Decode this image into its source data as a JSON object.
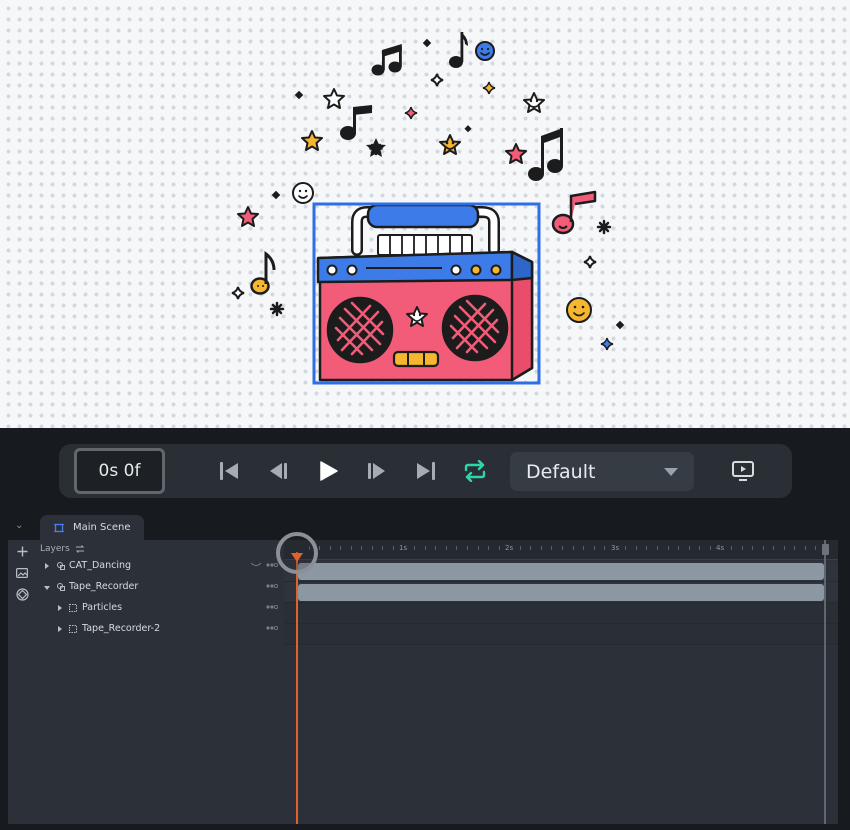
{
  "controls": {
    "timecode": "0s 0f",
    "preset": "Default"
  },
  "tabs": [
    {
      "label": "Main Scene"
    }
  ],
  "layers": {
    "header": "Layers",
    "items": [
      {
        "name": "CAT_Dancing",
        "level": 0,
        "expanded": false
      },
      {
        "name": "Tape_Recorder",
        "level": 0,
        "expanded": true
      },
      {
        "name": "Particles",
        "level": 1,
        "expanded": false
      },
      {
        "name": "Tape_Recorder-2",
        "level": 1,
        "expanded": false
      }
    ]
  },
  "timeline": {
    "ticks": [
      "1s",
      "2s",
      "3s",
      "4s"
    ],
    "playhead_seconds": 0,
    "duration_seconds": 5
  },
  "colors": {
    "accent_blue": "#2f6fe6",
    "playhead": "#e1622d",
    "loop_active": "#2fd5a8",
    "boombox_pink": "#f25c78",
    "boombox_blue": "#3d7ce8",
    "sticker_yellow": "#f6b62f"
  },
  "icons": [
    "skip-start-icon",
    "step-back-icon",
    "play-icon",
    "step-forward-icon",
    "skip-end-icon",
    "loop-icon",
    "preview-monitor-icon",
    "add-icon",
    "image-icon",
    "component-icon",
    "scene-icon",
    "group-icon",
    "frame-icon",
    "eye-icon",
    "swap-icon"
  ]
}
